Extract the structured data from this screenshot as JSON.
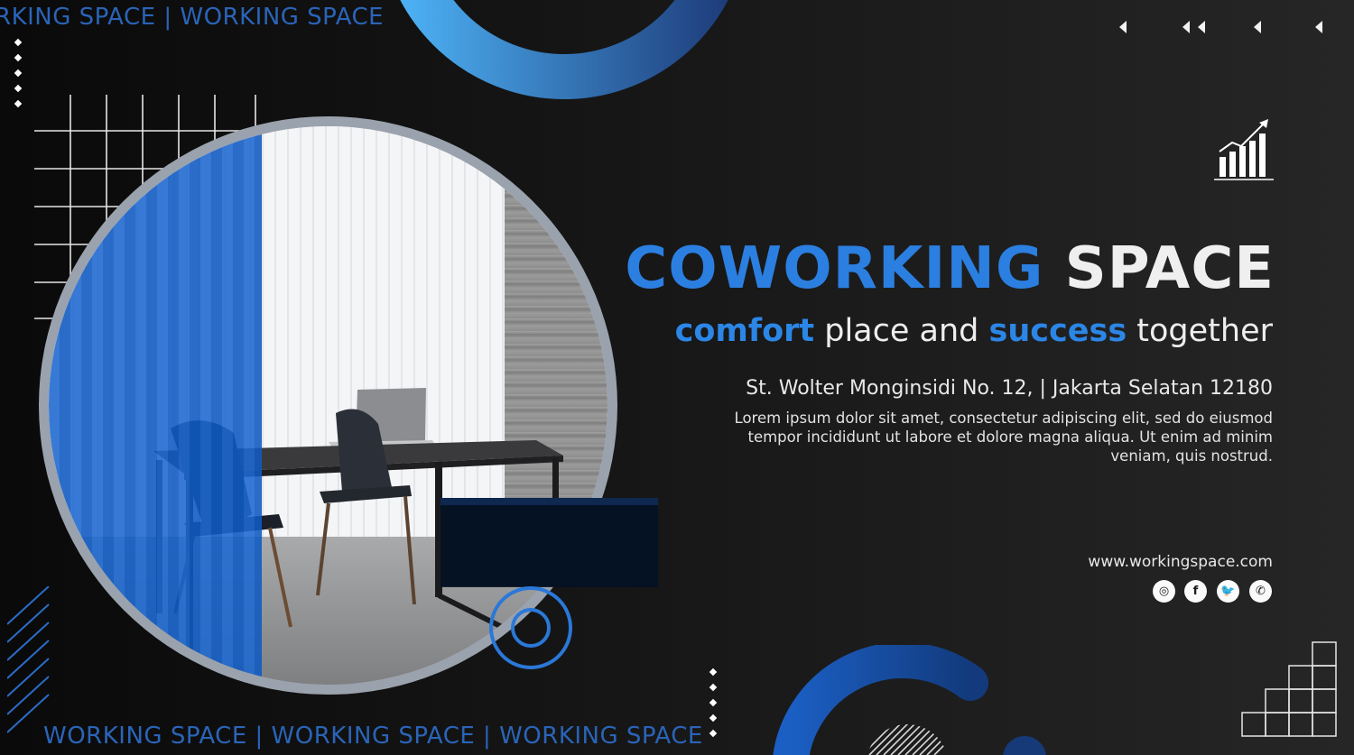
{
  "marquee": {
    "top": "RKING SPACE | WORKING SPACE",
    "bottom": "WORKING SPACE | WORKING SPACE | WORKING SPACE"
  },
  "title": {
    "part1": "COWORKING",
    "part2": " SPACE"
  },
  "tagline": {
    "w1": "comfort",
    "w2": " place and ",
    "w3": "success",
    "w4": " together"
  },
  "address": "St. Wolter Monginsidi No. 12, | Jakarta Selatan 12180",
  "description": "Lorem ipsum dolor sit amet, consectetur adipiscing elit, sed do eiusmod tempor incididunt ut labore et dolore magna aliqua. Ut enim ad minim veniam, quis nostrud.",
  "website": "www.workingspace.com",
  "social": [
    {
      "icon": "instagram-icon",
      "glyph": "◎"
    },
    {
      "icon": "facebook-icon",
      "glyph": "f"
    },
    {
      "icon": "twitter-icon",
      "glyph": "🐦"
    },
    {
      "icon": "whatsapp-icon",
      "glyph": "✆"
    }
  ],
  "colors": {
    "accent_blue": "#2b7fe0",
    "dark_bg": "#161616",
    "text_light": "#efefef"
  }
}
